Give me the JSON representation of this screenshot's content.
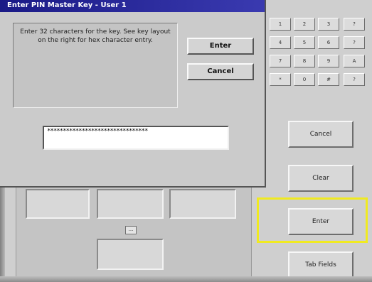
{
  "dialog": {
    "title": "Enter PIN Master Key - User 1",
    "message": "Enter 32 characters for the key. See key layout on the right for hex character entry.",
    "enter_label": "Enter",
    "cancel_label": "Cancel",
    "key_value": "********************************"
  },
  "keypad": {
    "rows": [
      [
        "1",
        "2",
        "3",
        "?"
      ],
      [
        "4",
        "5",
        "6",
        "?"
      ],
      [
        "7",
        "8",
        "9",
        "A"
      ],
      [
        "*",
        "0",
        "#",
        "?"
      ]
    ]
  },
  "side_buttons": {
    "button1": "Cancel",
    "button2": "Clear",
    "button3": "Enter",
    "button4": "Tab Fields"
  },
  "lower": {
    "mini_button": "..."
  },
  "colors": {
    "title_bar": "#1a1a86",
    "highlight": "#f0ea20",
    "panel": "#cfcfcf"
  }
}
